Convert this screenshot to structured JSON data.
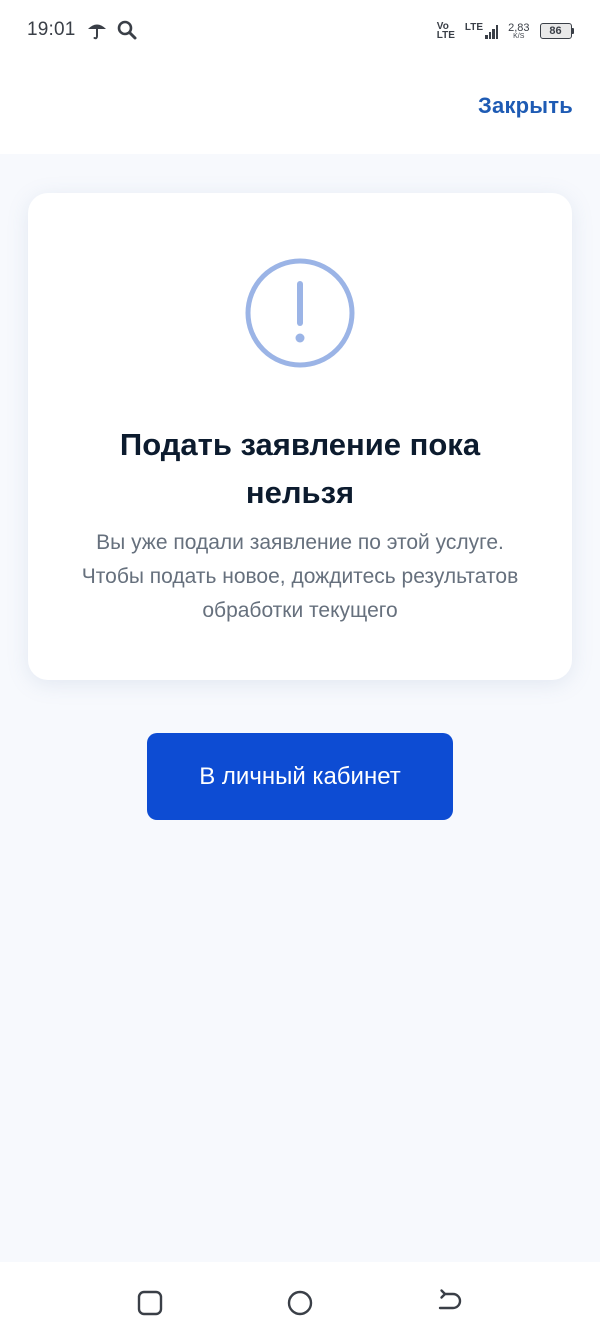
{
  "status_bar": {
    "time": "19:01",
    "left_icons": [
      "umbrella-icon",
      "search-icon"
    ],
    "volte_top": "Vo",
    "volte_bottom": "LTE",
    "network": "LTE",
    "signal_level": 4,
    "speed_value": "2,83",
    "speed_unit": "K/S",
    "battery": "86"
  },
  "header": {
    "close_label": "Закрыть"
  },
  "card": {
    "icon": "exclamation-circle-icon",
    "icon_color": "#9bb4e6",
    "title": "Подать заявление пока нельзя",
    "text": "Вы уже подали заявление по этой услуге. Чтобы подать новое, дождитесь результатов обработки текущего"
  },
  "primary_action": {
    "label": "В личный кабинет",
    "color": "#0d4cd3"
  },
  "navigation": {
    "buttons": [
      "recents-icon",
      "home-icon",
      "back-icon"
    ]
  },
  "colors": {
    "accent": "#1e5bb4",
    "title": "#0c1b2e",
    "body_text": "#66707d",
    "background": "#f7f9fd"
  }
}
